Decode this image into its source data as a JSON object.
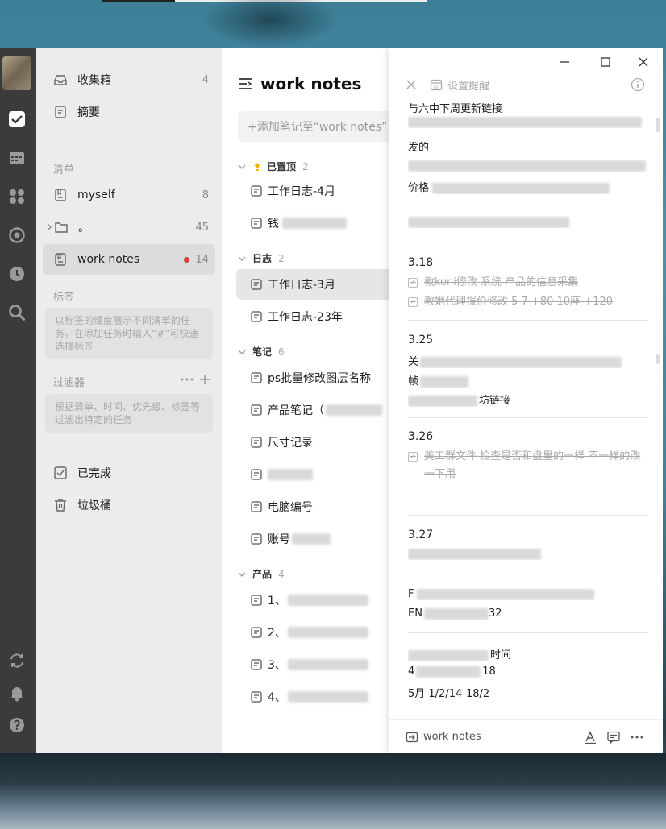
{
  "sidebar": {
    "inbox": {
      "label": "收集箱",
      "count": "4"
    },
    "summary": {
      "label": "摘要"
    },
    "lists_heading": "清单",
    "lists": [
      {
        "label": "myself",
        "count": "8"
      },
      {
        "label": "。",
        "count": "45"
      },
      {
        "label": "work notes",
        "count": "14"
      }
    ],
    "tags_heading": "标签",
    "tags_hint": "以标签的维度展示不同清单的任务。在添加任务时输入“#”可快速选择标签",
    "filters_heading": "过滤器",
    "filters_hint": "根据清单、时间、优先级、标签等过滤出特定的任务",
    "completed": "已完成",
    "trash": "垃圾桶"
  },
  "list": {
    "title": "work notes",
    "add_placeholder": "+添加笔记至“work notes”",
    "groups": [
      {
        "name": "已置顶",
        "count": "2",
        "items": [
          "工作日志-4月",
          "钱"
        ]
      },
      {
        "name": "日志",
        "count": "2",
        "items": [
          "工作日志-3月",
          "工作日志-23年"
        ]
      },
      {
        "name": "笔记",
        "count": "6",
        "items": [
          "ps批量修改图层名称",
          "产品笔记（",
          "尺寸记录",
          "",
          "电脑编号",
          "账号"
        ]
      },
      {
        "name": "产品",
        "count": "4",
        "items": [
          "1、",
          "2、",
          "3、",
          "4、"
        ]
      }
    ]
  },
  "detail": {
    "toolbar_label": "设置提醒",
    "lines_top": [
      "与六中下周更新链接",
      "发的",
      "价格"
    ],
    "sections": [
      {
        "title": "3.18",
        "tasks": [
          "教koni修改 系统 产品的信息采集",
          "教她代理报价修改 5 7 +80  10座 +120"
        ]
      },
      {
        "title": "3.25",
        "lines": [
          "关",
          "帧",
          "坊链接"
        ]
      },
      {
        "title": "3.26",
        "tasks": [
          "美工群文件 检查是否和盘里的一样 不一样的改一下用"
        ]
      },
      {
        "title": "3.27",
        "lines": [
          ""
        ]
      },
      {
        "title": "",
        "lines": [
          "F",
          "EN",
          "32"
        ]
      },
      {
        "title": "",
        "lines": [
          "时间",
          "4",
          "18",
          "5月 1/2/14-18/2"
        ]
      }
    ],
    "footer_list": "work notes"
  }
}
